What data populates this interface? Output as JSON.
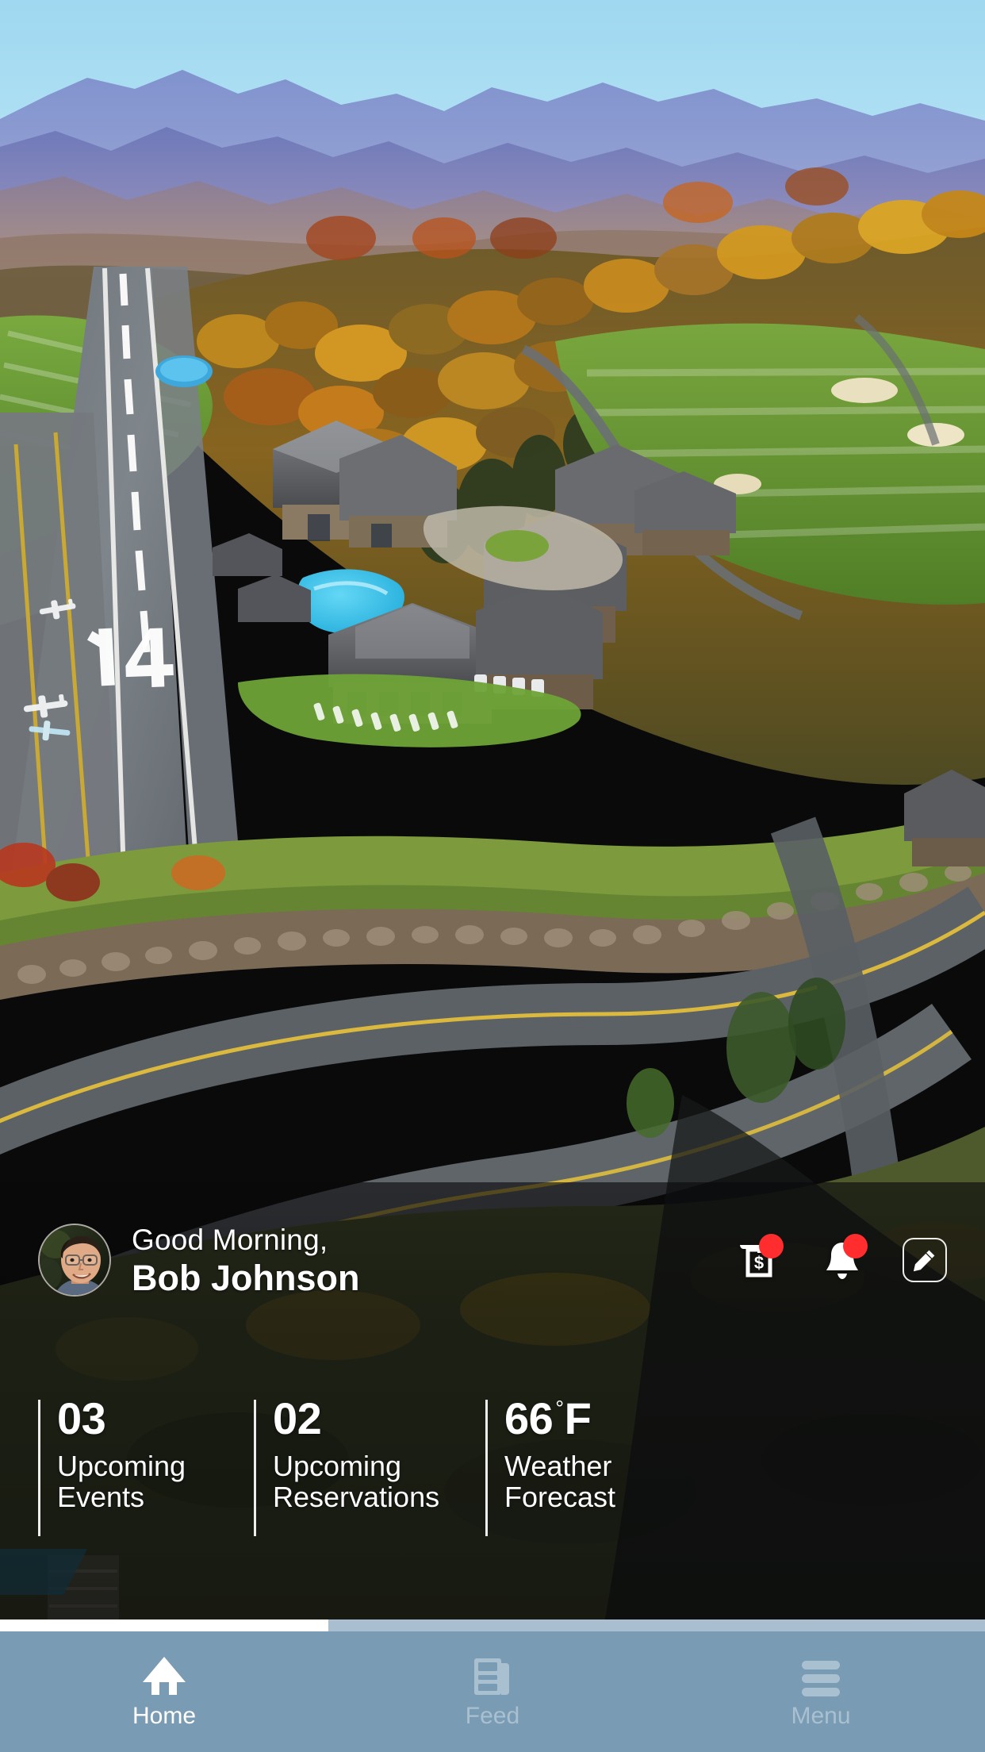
{
  "app": {
    "background_photo": {
      "description": "aerial view of mountain resort with airstrip, golf course and autumn foliage",
      "runway_marking": "14"
    }
  },
  "colors": {
    "nav_background": "#7a9bb4",
    "nav_indicator_active": "#ffffff",
    "nav_indicator_track": "#a9bfcf",
    "nav_label_active": "#ffffff",
    "nav_label_inactive": "#a9c0d0",
    "badge_red": "#ff2d2d",
    "overlay_dark": "#08080a",
    "sky_blue": "#a9ddf2",
    "mountain_blue": "#6f7fc2"
  },
  "header": {
    "greeting": "Good Morning,",
    "user_name": "Bob Johnson",
    "avatar_name": "user-avatar",
    "actions": [
      {
        "name": "billing-icon",
        "icon": "receipt-dollar-icon",
        "has_badge": true
      },
      {
        "name": "notifications-icon",
        "icon": "bell-icon",
        "has_badge": true
      },
      {
        "name": "edit-icon",
        "icon": "pencil-icon",
        "has_badge": false
      }
    ]
  },
  "stats": [
    {
      "value": "03",
      "degree": "",
      "unit": "",
      "label": "Upcoming\nEvents"
    },
    {
      "value": "02",
      "degree": "",
      "unit": "",
      "label": "Upcoming\nReservations"
    },
    {
      "value": "66",
      "degree": "°",
      "unit": "F",
      "label": "Weather\nForecast"
    }
  ],
  "bottom_nav": {
    "items": [
      {
        "label": "Home",
        "icon": "home-icon",
        "active": true
      },
      {
        "label": "Feed",
        "icon": "newspaper-icon",
        "active": false
      },
      {
        "label": "Menu",
        "icon": "hamburger-icon",
        "active": false
      }
    ]
  }
}
